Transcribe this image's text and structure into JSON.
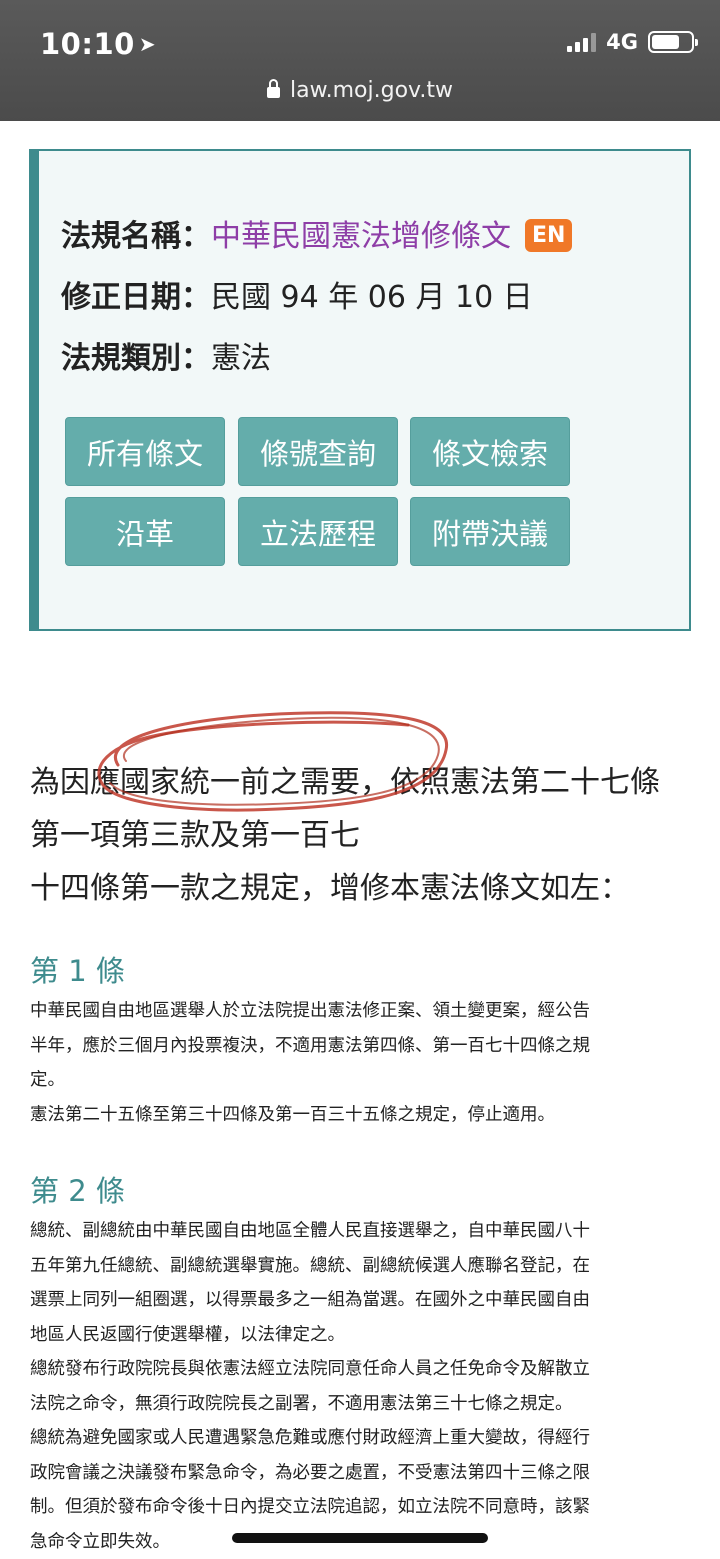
{
  "status_bar": {
    "time": "10:10",
    "network": "4G"
  },
  "browser": {
    "url": "law.moj.gov.tw"
  },
  "law_info": {
    "name_label": "法規名稱：",
    "name": "中華民國憲法增修條文",
    "en_badge": "EN",
    "date_label": "修正日期：",
    "date": "民國 94 年 06 月 10 日",
    "category_label": "法規類別：",
    "category": "憲法"
  },
  "buttons": [
    "所有條文",
    "條號查詢",
    "條文檢索",
    "沿革",
    "立法歷程",
    "附帶決議"
  ],
  "preamble": [
    "為因應國家統一前之需要，依照憲法第二十七條",
    "第一項第三款及第一百七",
    "十四條第一款之規定，增修本憲法條文如左："
  ],
  "articles": [
    {
      "title": "第 1 條",
      "lines": [
        "中華民國自由地區選舉人於立法院提出憲法修正案、領土變更案，經公告",
        "半年，應於三個月內投票複決，不適用憲法第四條、第一百七十四條之規",
        "定。",
        "憲法第二十五條至第三十四條及第一百三十五條之規定，停止適用。"
      ]
    },
    {
      "title": "第 2 條",
      "lines": [
        "總統、副總統由中華民國自由地區全體人民直接選舉之，自中華民國八十",
        "五年第九任總統、副總統選舉實施。總統、副總統候選人應聯名登記，在",
        "選票上同列一組圈選，以得票最多之一組為當選。在國外之中華民國自由",
        "地區人民返國行使選舉權，以法律定之。",
        "總統發布行政院院長與依憲法經立法院同意任命人員之任免命令及解散立",
        "法院之命令，無須行政院院長之副署，不適用憲法第三十七條之規定。",
        "總統為避免國家或人民遭遇緊急危難或應付財政經濟上重大變故，得經行",
        "政院會議之決議發布緊急命令，為必要之處置，不受憲法第四十三條之限",
        "制。但須於發布命令後十日內提交立法院追認，如立法院不同意時，該緊",
        "急命令立即失效。"
      ]
    }
  ],
  "colors": {
    "teal": "#3e8b8d",
    "button": "#64adab",
    "law_name": "#8e3ea7",
    "badge": "#f07828",
    "scribble": "#c0392b"
  }
}
